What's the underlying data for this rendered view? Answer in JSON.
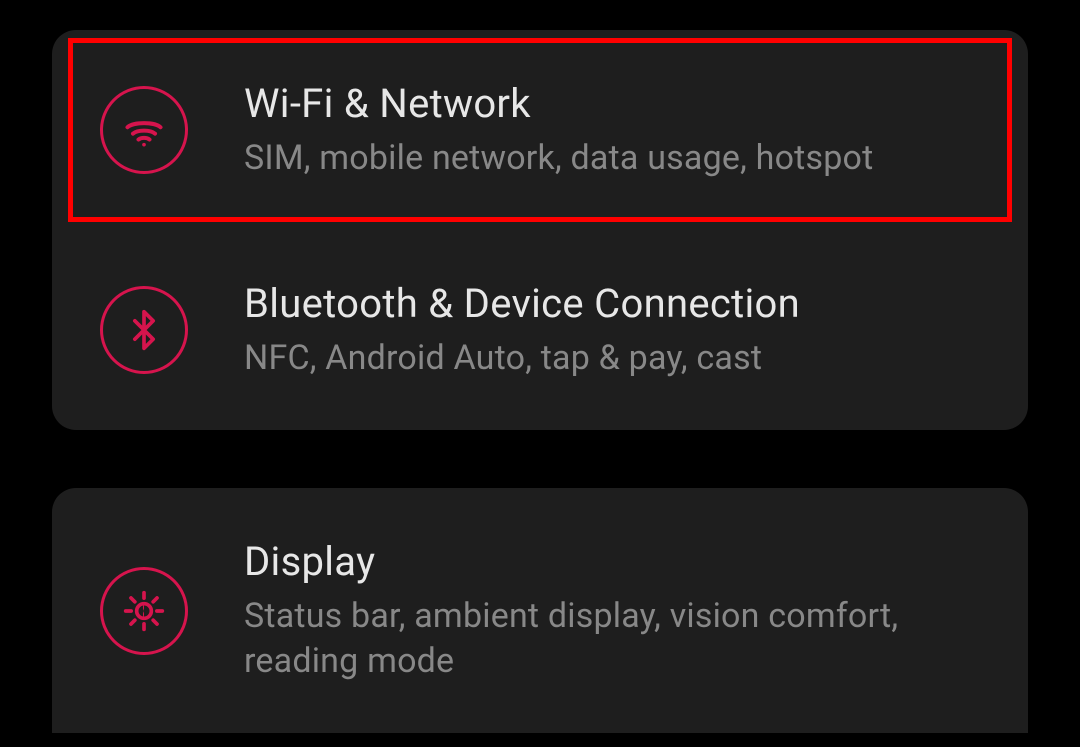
{
  "colors": {
    "accent": "#d6144d",
    "card_bg": "#1e1e1e",
    "highlight_border": "#ff0000",
    "title_text": "#e7e7e7",
    "subtitle_text": "#888888"
  },
  "cards": [
    {
      "items": [
        {
          "icon": "wifi-icon",
          "title": "Wi-Fi & Network",
          "subtitle": "SIM, mobile network, data usage, hotspot",
          "highlighted": true
        },
        {
          "icon": "bluetooth-icon",
          "title": "Bluetooth & Device Connection",
          "subtitle": "NFC, Android Auto, tap & pay, cast",
          "highlighted": false
        }
      ]
    },
    {
      "items": [
        {
          "icon": "brightness-icon",
          "title": "Display",
          "subtitle": "Status bar, ambient display, vision comfort, reading mode",
          "highlighted": false
        }
      ]
    }
  ]
}
